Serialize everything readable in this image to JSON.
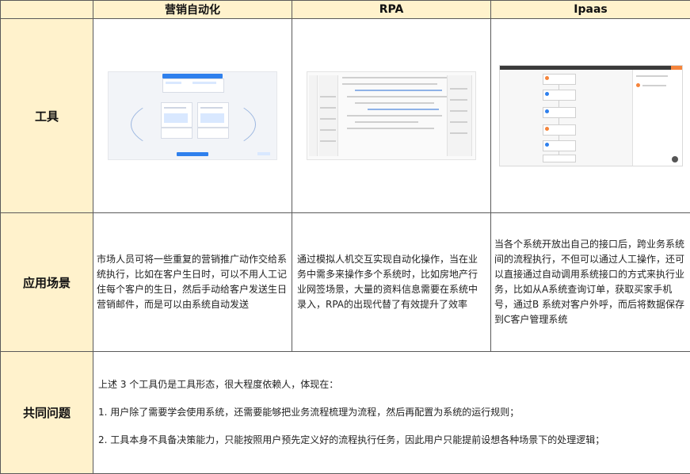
{
  "header": {
    "col1": "营销自动化",
    "col2": "RPA",
    "col3": "Ipaas"
  },
  "rows": {
    "tools_label": "工具",
    "scenario_label": "应用场景",
    "common_label": "共同问题"
  },
  "scenarios": {
    "marketing": "市场人员可将一些重复的营销推广动作交给系统执行，比如在客户生日时，可以不用人工记住每个客户的生日，然后手动给客户发送生日营销邮件，而是可以由系统自动发送",
    "rpa": "通过模拟人机交互实现自动化操作，当在业务中需多来操作多个系统时，比如房地产行业网签场景，大量的资料信息需要在系统中录入，RPA的出现代替了有效提升了效率",
    "ipaas": "当各个系统开放出自己的接口后，跨业务系统间的流程执行，不但可以通过人工操作，还可以直接通过自动调用系统接口的方式来执行业务，比如从A系统查询订单，获取买家手机号，通过B 系统对客户外呼，而后将数据保存到C客户管理系统"
  },
  "common": {
    "intro": "上述 3 个工具仍是工具形态，很大程度依赖人，体现在：",
    "point1": "1. 用户除了需要学会使用系统，还需要能够把业务流程梳理为流程，然后再配置为系统的运行规则；",
    "point2": "2. 工具本身不具备决策能力，只能按照用户预先定义好的流程执行任务，因此用户只能提前设想各种场景下的处理逻辑；"
  },
  "colors": {
    "header_bg": "#fff2cc",
    "border": "#5a5a5a",
    "accent_blue": "#2f80ed",
    "accent_orange": "#f5843b"
  }
}
